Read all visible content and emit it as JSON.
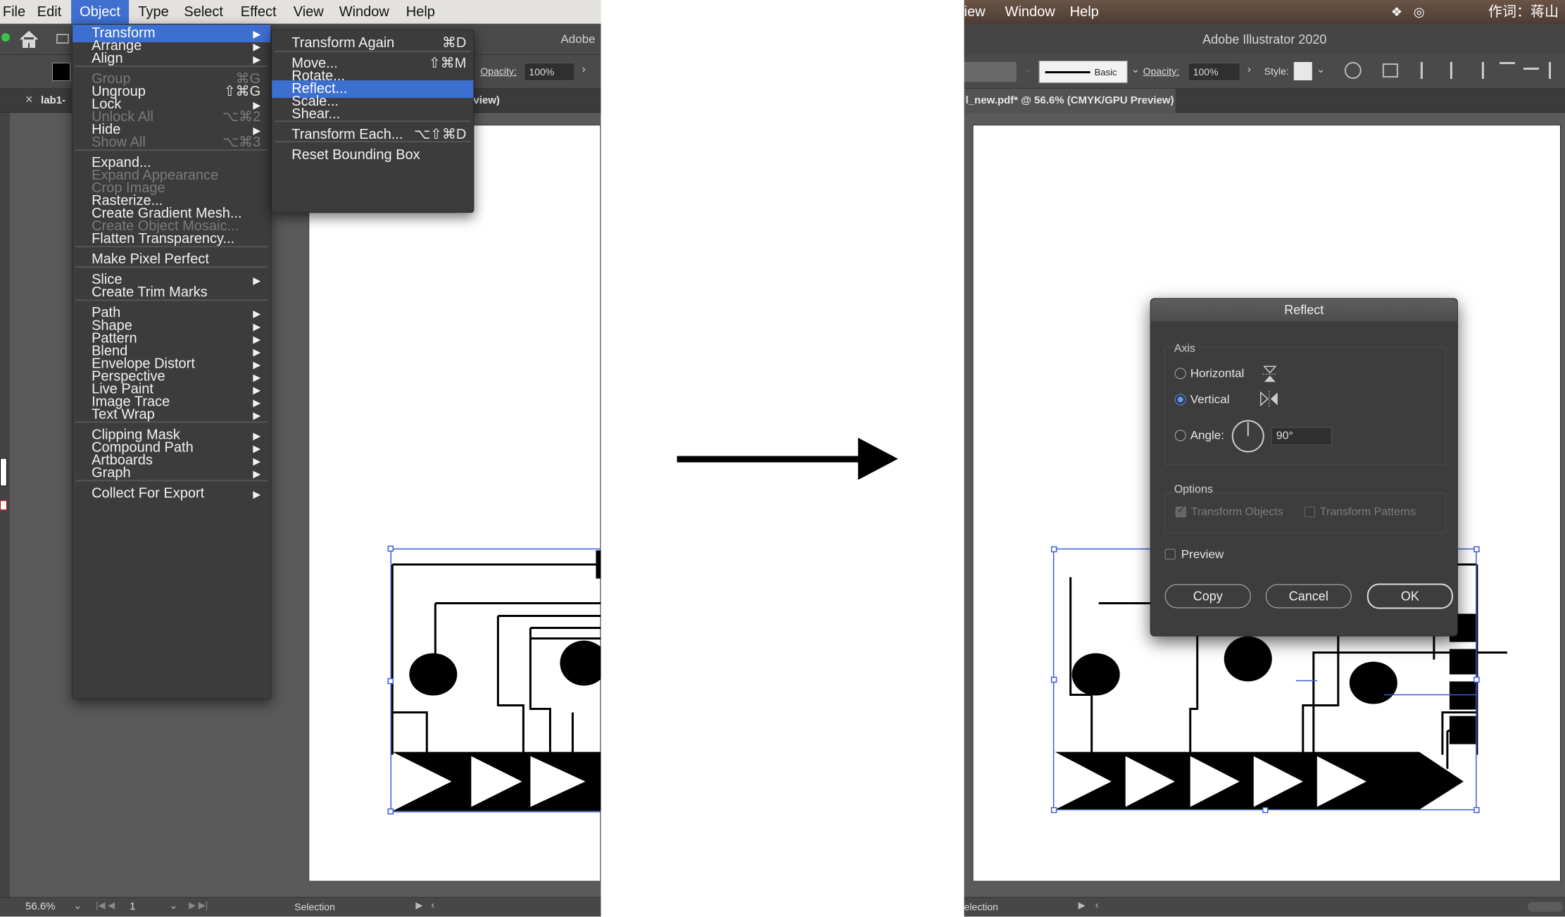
{
  "left_screenshot": {
    "menubar": {
      "items": [
        "File",
        "Edit",
        "Object",
        "Type",
        "Select",
        "Effect",
        "View",
        "Window",
        "Help"
      ],
      "active": "Object"
    },
    "toolbar": {
      "app_label": "Adobe",
      "opacity_label": "Opacity:",
      "opacity_value": "100%"
    },
    "tab": {
      "close": "×",
      "label": "lab1-",
      "label_tail": "view)"
    },
    "object_menu": {
      "items": [
        {
          "label": "Transform",
          "shortcut": "",
          "submenu": true,
          "highlighted": true
        },
        {
          "label": "Arrange",
          "shortcut": "",
          "submenu": true
        },
        {
          "label": "Align",
          "shortcut": "",
          "submenu": true
        },
        {
          "label": "Group",
          "shortcut": "⌘G",
          "disabled": true
        },
        {
          "label": "Ungroup",
          "shortcut": "⇧⌘G"
        },
        {
          "label": "Lock",
          "shortcut": "",
          "submenu": true
        },
        {
          "label": "Unlock All",
          "shortcut": "⌥⌘2",
          "disabled": true
        },
        {
          "label": "Hide",
          "shortcut": "",
          "submenu": true
        },
        {
          "label": "Show All",
          "shortcut": "⌥⌘3",
          "disabled": true
        },
        {
          "label": "Expand...",
          "shortcut": ""
        },
        {
          "label": "Expand Appearance",
          "shortcut": "",
          "disabled": true
        },
        {
          "label": "Crop Image",
          "shortcut": "",
          "disabled": true
        },
        {
          "label": "Rasterize...",
          "shortcut": ""
        },
        {
          "label": "Create Gradient Mesh...",
          "shortcut": ""
        },
        {
          "label": "Create Object Mosaic...",
          "shortcut": "",
          "disabled": true
        },
        {
          "label": "Flatten Transparency...",
          "shortcut": ""
        },
        {
          "label": "Make Pixel Perfect",
          "shortcut": ""
        },
        {
          "label": "Slice",
          "shortcut": "",
          "submenu": true
        },
        {
          "label": "Create Trim Marks",
          "shortcut": ""
        },
        {
          "label": "Path",
          "shortcut": "",
          "submenu": true
        },
        {
          "label": "Shape",
          "shortcut": "",
          "submenu": true
        },
        {
          "label": "Pattern",
          "shortcut": "",
          "submenu": true
        },
        {
          "label": "Blend",
          "shortcut": "",
          "submenu": true
        },
        {
          "label": "Envelope Distort",
          "shortcut": "",
          "submenu": true
        },
        {
          "label": "Perspective",
          "shortcut": "",
          "submenu": true
        },
        {
          "label": "Live Paint",
          "shortcut": "",
          "submenu": true
        },
        {
          "label": "Image Trace",
          "shortcut": "",
          "submenu": true
        },
        {
          "label": "Text Wrap",
          "shortcut": "",
          "submenu": true
        },
        {
          "label": "Clipping Mask",
          "shortcut": "",
          "submenu": true
        },
        {
          "label": "Compound Path",
          "shortcut": "",
          "submenu": true
        },
        {
          "label": "Artboards",
          "shortcut": "",
          "submenu": true
        },
        {
          "label": "Graph",
          "shortcut": "",
          "submenu": true
        },
        {
          "label": "Collect For Export",
          "shortcut": "",
          "submenu": true
        }
      ]
    },
    "transform_submenu": {
      "items": [
        {
          "label": "Transform Again",
          "shortcut": "⌘D"
        },
        {
          "label": "Move...",
          "shortcut": "⇧⌘M"
        },
        {
          "label": "Rotate...",
          "shortcut": ""
        },
        {
          "label": "Reflect...",
          "shortcut": "",
          "highlighted": true
        },
        {
          "label": "Scale...",
          "shortcut": ""
        },
        {
          "label": "Shear...",
          "shortcut": ""
        },
        {
          "label": "Transform Each...",
          "shortcut": "⌥⇧⌘D"
        },
        {
          "label": "Reset Bounding Box",
          "shortcut": ""
        }
      ]
    },
    "status": {
      "zoom": "56.6%",
      "artboard": "1",
      "tool": "Selection"
    }
  },
  "right_screenshot": {
    "menubar": {
      "items": [
        "iew",
        "Window",
        "Help"
      ],
      "right_text": "作词：蒋山"
    },
    "app_title": "Adobe Illustrator 2020",
    "toolbar": {
      "stroke_style": "Basic",
      "opacity_label": "Opacity:",
      "opacity_value": "100%",
      "style_label": "Style:"
    },
    "tab_label": "l_new.pdf* @ 56.6% (CMYK/GPU Preview)",
    "status": {
      "tool": "election"
    },
    "reflect_dialog": {
      "title": "Reflect",
      "axis_label": "Axis",
      "horizontal_label": "Horizontal",
      "vertical_label": "Vertical",
      "angle_label": "Angle:",
      "angle_value": "90°",
      "selected_axis": "Vertical",
      "options_label": "Options",
      "transform_objects_label": "Transform Objects",
      "transform_patterns_label": "Transform Patterns",
      "preview_label": "Preview",
      "copy_button": "Copy",
      "cancel_button": "Cancel",
      "ok_button": "OK"
    }
  },
  "colors": {
    "menu_highlight": "#3d6fd0",
    "menu_bg": "#3c3c3c",
    "dialog_bg": "#3d3d3d",
    "selection_blue": "#3b5bdb"
  }
}
